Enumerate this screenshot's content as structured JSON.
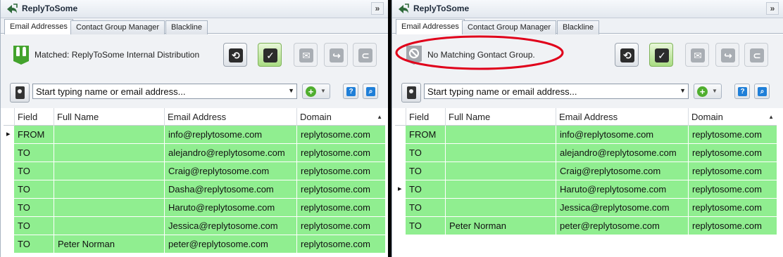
{
  "app_title": "ReplyToSome",
  "tabs": [
    "Email Addresses",
    "Contact Group Manager",
    "Blackline"
  ],
  "search": {
    "placeholder": "Start typing name or email address..."
  },
  "columns": [
    "Field",
    "Full Name",
    "Email Address",
    "Domain"
  ],
  "colors": {
    "row_green": "#90ee90",
    "accent_green": "#4fae2e",
    "highlight_red": "#e0001a"
  },
  "panels": [
    {
      "status_icon": "matched-group-icon",
      "status_text": "Matched: ReplyToSome Internal Distribution",
      "active_row_index": 0,
      "rows": [
        {
          "field": "FROM",
          "name": "",
          "email": "info@replytosome.com",
          "domain": "replytosome.com"
        },
        {
          "field": "TO",
          "name": "",
          "email": "alejandro@replytosome.com",
          "domain": "replytosome.com"
        },
        {
          "field": "TO",
          "name": "",
          "email": "Craig@replytosome.com",
          "domain": "replytosome.com"
        },
        {
          "field": "TO",
          "name": "",
          "email": "Dasha@replytosome.com",
          "domain": "replytosome.com"
        },
        {
          "field": "TO",
          "name": "",
          "email": "Haruto@replytosome.com",
          "domain": "replytosome.com"
        },
        {
          "field": "TO",
          "name": "",
          "email": "Jessica@replytosome.com",
          "domain": "replytosome.com"
        },
        {
          "field": "TO",
          "name": "Peter Norman",
          "email": "peter@replytosome.com",
          "domain": "replytosome.com"
        }
      ]
    },
    {
      "status_icon": "no-match-icon",
      "status_text": "No Matching Gontact Group.",
      "active_row_index": 3,
      "rows": [
        {
          "field": "FROM",
          "name": "",
          "email": "info@replytosome.com",
          "domain": "replytosome.com"
        },
        {
          "field": "TO",
          "name": "",
          "email": "alejandro@replytosome.com",
          "domain": "replytosome.com"
        },
        {
          "field": "TO",
          "name": "",
          "email": "Craig@replytosome.com",
          "domain": "replytosome.com"
        },
        {
          "field": "TO",
          "name": "",
          "email": "Haruto@replytosome.com",
          "domain": "replytosome.com"
        },
        {
          "field": "TO",
          "name": "",
          "email": "Jessica@replytosome.com",
          "domain": "replytosome.com"
        },
        {
          "field": "TO",
          "name": "Peter Norman",
          "email": "peter@replytosome.com",
          "domain": "replytosome.com"
        }
      ]
    }
  ]
}
